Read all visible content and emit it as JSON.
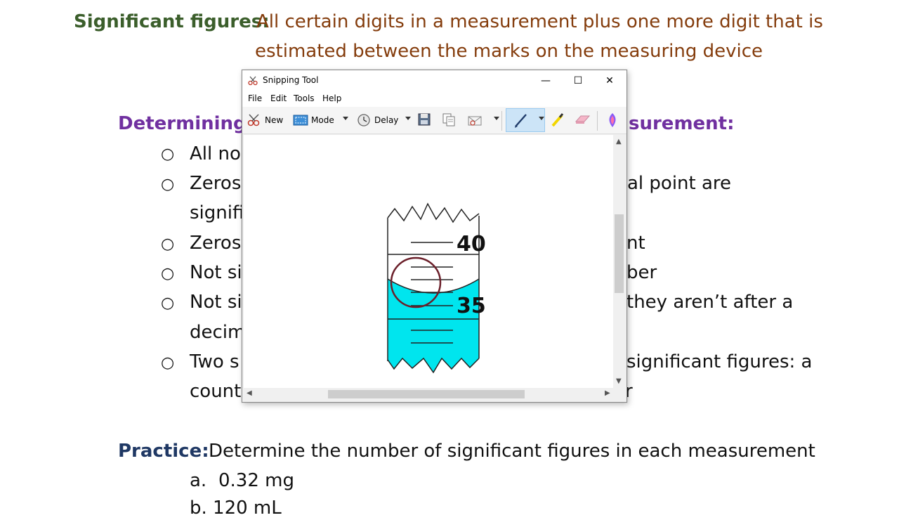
{
  "doc": {
    "sigfig_label": "Significant figures:",
    "sigfig_def_line1": "All certain digits in a measurement plus one more digit that is",
    "sigfig_def_line2": "estimated between the marks on the measuring device",
    "determining_left": "Determining t",
    "determining_right": "surement:",
    "bullets": [
      {
        "left": "All no",
        "right": ""
      },
      {
        "left": "Zeros",
        "right": "al point are"
      },
      {
        "left": "signifi",
        "right": ""
      },
      {
        "left": "Zeros",
        "right": "nt"
      },
      {
        "left": "Not si",
        "right": "ber"
      },
      {
        "left": "Not si",
        "right": "they aren’t after a"
      },
      {
        "left": "decim",
        "right": ""
      },
      {
        "left": "Two s",
        "right": "significant figures:  a"
      },
      {
        "left": "count",
        "right": "r"
      }
    ],
    "bullet_glyph": "○",
    "practice_label": "Practice:",
    "practice_text": "Determine the number of significant figures in each measurement",
    "item_a_letter": "a.",
    "item_a_text": "0.32 mg",
    "item_b_partial": "b.   120 mL"
  },
  "window": {
    "title": "Snipping Tool",
    "menus": [
      "File",
      "Edit",
      "Tools",
      "Help"
    ],
    "toolbar": {
      "new_label": "New",
      "mode_label": "Mode",
      "delay_label": "Delay"
    },
    "close_glyph": "✕",
    "min_glyph": "—",
    "max_glyph": "☐"
  },
  "snip": {
    "mark_upper": "40",
    "mark_lower": "35",
    "liquid_color": "#00e5ee"
  }
}
